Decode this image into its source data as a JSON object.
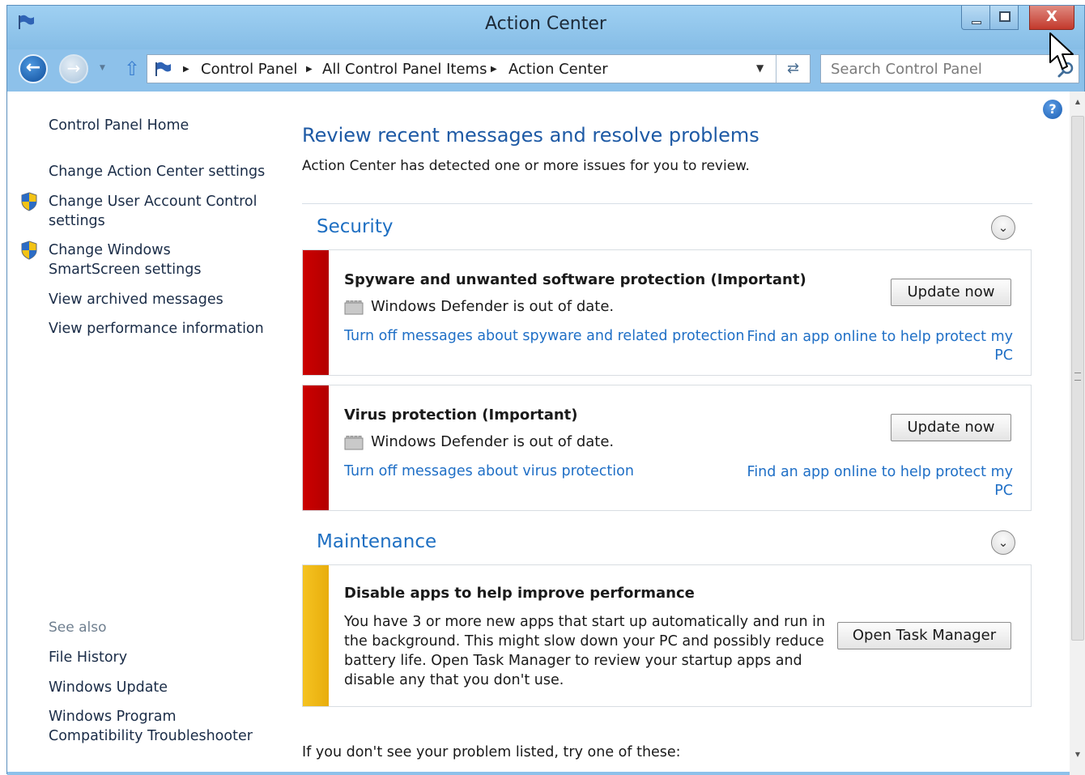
{
  "window": {
    "title": "Action Center",
    "close_glyph": "X"
  },
  "navigation": {
    "back_icon": "back-arrow-icon",
    "breadcrumbs": [
      "Control Panel",
      "All Control Panel Items",
      "Action Center"
    ],
    "search": {
      "placeholder": "Search Control Panel",
      "value": ""
    }
  },
  "sidebar": {
    "links": [
      {
        "label": "Control Panel Home",
        "shield": false
      },
      {
        "label": "Change Action Center settings",
        "shield": false
      },
      {
        "label": "Change User Account Control settings",
        "shield": true
      },
      {
        "label": "Change Windows SmartScreen settings",
        "shield": true
      },
      {
        "label": "View archived messages",
        "shield": false
      },
      {
        "label": "View performance information",
        "shield": false
      }
    ],
    "see_also_label": "See also",
    "see_also_links": [
      "File History",
      "Windows Update",
      "Windows Program Compatibility Troubleshooter"
    ]
  },
  "main": {
    "title": "Review recent messages and resolve problems",
    "subtitle": "Action Center has detected one or more issues for you to review.",
    "help_glyph": "?",
    "sections": [
      {
        "title": "Security",
        "cards": [
          {
            "title": "Spyware and unwanted software protection  (Important)",
            "status": "Windows Defender is out of date.",
            "link_left": "Turn off messages about spyware and related protection",
            "link_right": "Find an app online to help protect my PC",
            "button": "Update now",
            "severity_color": "#c80000"
          },
          {
            "title": "Virus protection  (Important)",
            "status": "Windows Defender is out of date.",
            "link_left": "Turn off messages about virus protection",
            "link_right": "Find an app online to help protect my PC",
            "button": "Update now",
            "severity_color": "#c80000"
          }
        ]
      },
      {
        "title": "Maintenance",
        "cards": [
          {
            "title": "Disable apps to help improve performance",
            "body": "You have 3 or more new apps that start up automatically and run in the background. This might slow down your PC and possibly reduce battery life. Open Task Manager to review your startup apps and disable any that you don't use.",
            "button": "Open Task Manager",
            "severity_color": "#f0b915"
          }
        ]
      }
    ],
    "footer": "If you don't see your problem listed, try one of these:"
  },
  "colors": {
    "chrome": "#8dc1ea",
    "link": "#1f6fc6",
    "heading": "#1e5aa5",
    "important": "#c80000",
    "warning": "#f0b915",
    "close_button": "#c3392c"
  }
}
